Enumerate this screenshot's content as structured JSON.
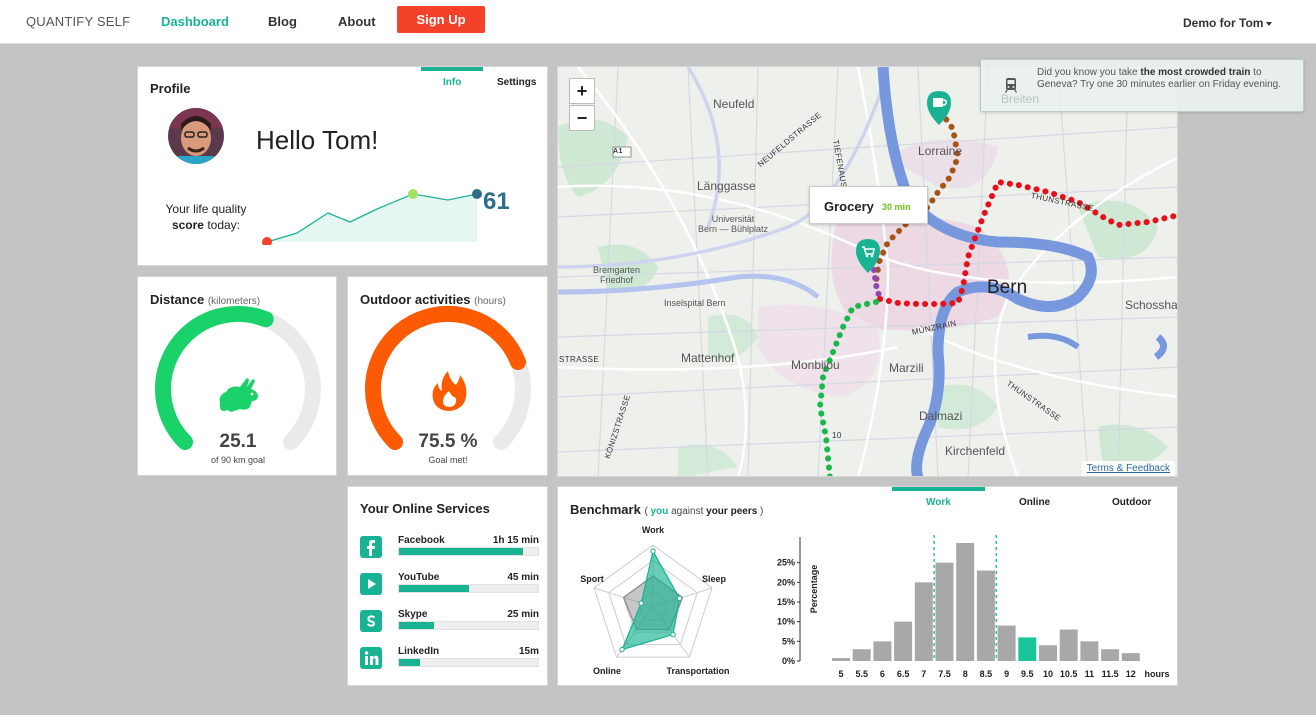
{
  "nav": {
    "brand": "QUANTIFY SELF",
    "links": [
      "Dashboard",
      "Blog",
      "About"
    ],
    "signup": "Sign Up",
    "user": "Demo for Tom"
  },
  "colors": {
    "accent": "#19b394",
    "signup": "#f4412a",
    "score": "#2e6e8a",
    "distance": "#19d36a",
    "outdoor": "#fc5a03"
  },
  "profile": {
    "title": "Profile",
    "tabs": [
      "Info",
      "Settings"
    ],
    "greeting": "Hello Tom!",
    "life_line1": "Your life quality",
    "life_bold": "score",
    "life_rest": "today:",
    "score": "61"
  },
  "distance": {
    "title": "Distance",
    "unit": "(kilometers)",
    "value": "25.1",
    "sub": "of 90 km goal",
    "fraction": 0.58,
    "icon": "rabbit-icon"
  },
  "outdoor": {
    "title": "Outdoor activities",
    "unit": "(hours)",
    "value": "75.5 %",
    "sub": "Goal met!",
    "fraction": 0.755,
    "icon": "flame-icon"
  },
  "map": {
    "zoom_in": "+",
    "zoom_out": "−",
    "popup_title": "Grocery",
    "popup_time": "30 min",
    "attribution": "Terms & Feedback",
    "labels": {
      "neufeld": "Neufeld",
      "lorraine": "Lorraine",
      "langgasse": "Länggasse",
      "uni1": "Universität",
      "uni2": "Bern — Bühlplatz",
      "bremgarten1": "Bremgarten",
      "bremgarten2": "Friedhof",
      "insel": "Inselspital Bern",
      "bern": "Bern",
      "schossha": "Schossha",
      "mattenhof": "Mattenhof",
      "monbijou": "Monbijou",
      "marzili": "Marzili",
      "dalmazi": "Dalmazi",
      "kirchenfeld": "Kirchenfeld",
      "a1": "A1",
      "tiefenau": "TIEFENAUSTRASSE",
      "neufeldstr": "NEUFELDSTRASSE",
      "strasse": "STRASSE",
      "konizstr": "KÖNIZSTRASSE",
      "thunstr": "THUNSTRASSE",
      "munzrain": "MÜNZRAIN",
      "route_label": "10",
      "breiten": "Breiten"
    }
  },
  "tip": {
    "pre": "Did you know you take ",
    "bold": "the most crowded train",
    "post": " to Geneva? Try one 30 minutes earlier on Friday evening."
  },
  "services": {
    "title": "Your Online Services",
    "items": [
      {
        "name": "Facebook",
        "time": "1h 15 min",
        "fraction": 0.89,
        "icon": "facebook-icon"
      },
      {
        "name": "YouTube",
        "time": "45 min",
        "fraction": 0.5,
        "icon": "youtube-icon"
      },
      {
        "name": "Skype",
        "time": "25 min",
        "fraction": 0.25,
        "icon": "skype-icon"
      },
      {
        "name": "LinkedIn",
        "time": "15m",
        "fraction": 0.15,
        "icon": "linkedin-icon"
      }
    ]
  },
  "benchmark": {
    "title": "Benchmark",
    "paren_open": "( ",
    "you": "you",
    "against": " against ",
    "peers": "your peers",
    "paren_close": " )",
    "tabs": [
      "Work",
      "Online",
      "Outdoor"
    ],
    "radar_axes": [
      "Work",
      "Sleep",
      "Transportation",
      "Online",
      "Sport"
    ],
    "radar_you": [
      0.9,
      0.45,
      0.55,
      0.85,
      0.2
    ],
    "radar_peers": [
      0.5,
      0.5,
      0.45,
      0.45,
      0.5
    ],
    "ylabel": "Percentage",
    "xunit": "hours"
  },
  "chart_data": {
    "type": "bar",
    "title": "Benchmark",
    "xlabel": "hours",
    "ylabel": "Percentage",
    "categories": [
      "5",
      "5.5",
      "6",
      "6.5",
      "7",
      "7.5",
      "8",
      "8.5",
      "9",
      "9.5",
      "10",
      "10.5",
      "11",
      "11.5",
      "12"
    ],
    "values": [
      1.5,
      6,
      10,
      20,
      40,
      50,
      60,
      46,
      18,
      12,
      8,
      16,
      10,
      6,
      4
    ],
    "highlight": "9.5",
    "yticks": [
      "0%",
      "5%",
      "10%",
      "15%",
      "20%",
      "25%"
    ],
    "ylim": [
      0,
      60
    ],
    "reference_lines": [
      "7.25",
      "8.75"
    ]
  }
}
